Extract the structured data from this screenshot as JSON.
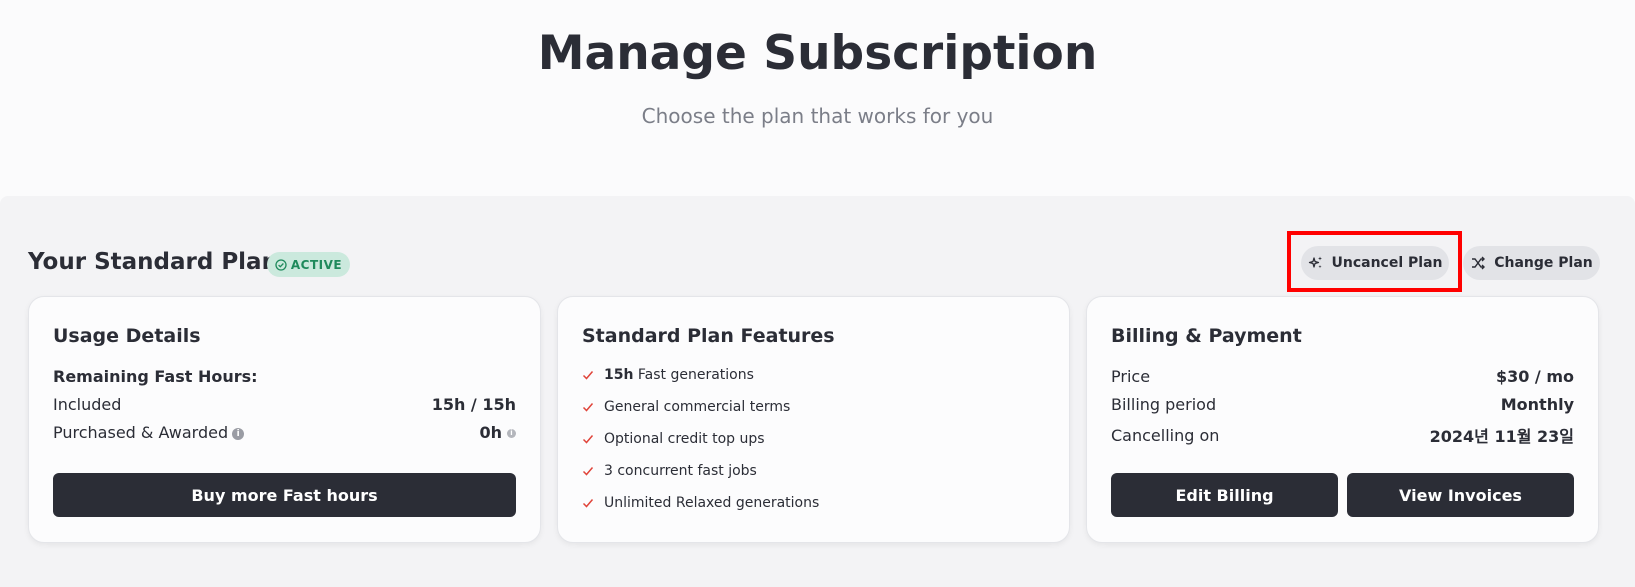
{
  "header": {
    "title": "Manage Subscription",
    "subtitle": "Choose the plan that works for you"
  },
  "plan": {
    "title": "Your Standard Plan",
    "status_badge": "ACTIVE",
    "uncancel_label": "Uncancel Plan",
    "change_label": "Change Plan"
  },
  "usage": {
    "title": "Usage Details",
    "remaining_label": "Remaining Fast Hours:",
    "included_label": "Included",
    "included_value": "15h / 15h",
    "purchased_label": "Purchased & Awarded",
    "purchased_value": "0h",
    "buy_button": "Buy more Fast hours"
  },
  "features": {
    "title": "Standard Plan Features",
    "items": [
      {
        "bold": "15h",
        "text": " Fast generations"
      },
      {
        "bold": "",
        "text": "General commercial terms"
      },
      {
        "bold": "",
        "text": "Optional credit top ups"
      },
      {
        "bold": "",
        "text": "3 concurrent fast jobs"
      },
      {
        "bold": "",
        "text": "Unlimited Relaxed generations"
      }
    ]
  },
  "billing": {
    "title": "Billing & Payment",
    "price_label": "Price",
    "price_value": "$30 / mo",
    "period_label": "Billing period",
    "period_value": "Monthly",
    "cancel_label": "Cancelling on",
    "cancel_value": "2024년 11월 23일",
    "edit_button": "Edit Billing",
    "invoices_button": "View Invoices"
  },
  "colors": {
    "dark": "#2b2d36",
    "active_green": "#1f8a5c",
    "check_red": "#e0443a",
    "highlight": "#ff0000"
  }
}
